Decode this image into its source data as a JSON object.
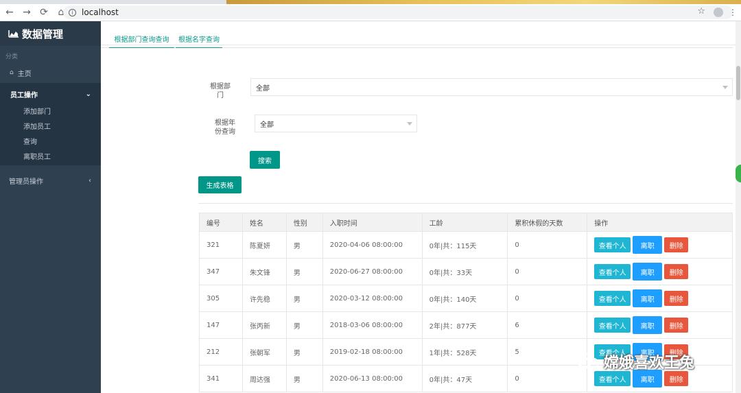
{
  "browser": {
    "url": "localhost",
    "nav_icons": [
      "back-icon",
      "forward-icon",
      "reload-icon",
      "home-icon"
    ],
    "back": "←",
    "forward": "→",
    "reload": "⟳",
    "home": "⌂",
    "info": "i",
    "star": "☆"
  },
  "sidebar": {
    "brand": "数据管理",
    "section_label": "分类",
    "home": "主页",
    "employee_group": {
      "label": "员工操作",
      "items": [
        "添加部门",
        "添加员工",
        "查询",
        "离职员工"
      ]
    },
    "admin_group": {
      "label": "管理员操作"
    }
  },
  "tabs": [
    "根据部门查询查询",
    "根据名字查询"
  ],
  "form": {
    "dept_label": "根据部\n门",
    "dept_value": "全部",
    "year_label": "根据年\n份查询",
    "year_value": "全部",
    "search_button": "搜索",
    "generate_button": "生成表格"
  },
  "table": {
    "headers": [
      "编号",
      "姓名",
      "性别",
      "入职时间",
      "工龄",
      "累积休假的天数",
      "操作"
    ],
    "rows": [
      [
        "321",
        "陈夏妍",
        "男",
        "2020-04-06 08:00:00",
        "0年|共：115天",
        "0"
      ],
      [
        "347",
        "朱文锋",
        "男",
        "2020-06-27 08:00:00",
        "0年|共：33天",
        "0"
      ],
      [
        "305",
        "许先稳",
        "男",
        "2020-03-12 08:00:00",
        "0年|共：140天",
        "0"
      ],
      [
        "147",
        "张丙新",
        "男",
        "2018-03-06 08:00:00",
        "2年|共：877天",
        "6"
      ],
      [
        "212",
        "张朝军",
        "男",
        "2019-02-18 08:00:00",
        "1年|共：528天",
        "5"
      ],
      [
        "341",
        "周达强",
        "男",
        "2020-06-13 08:00:00",
        "0年|共：47天",
        "0"
      ]
    ],
    "actions": {
      "view": "查看个人",
      "leave": "离职",
      "delete": "删除"
    }
  },
  "watermark": "嫦娥喜欢王兔",
  "colors": {
    "accent": "#009688",
    "sidebar": "#2f4050",
    "view": "#1eb6d3",
    "leave": "#1e9fff",
    "delete": "#e8573c"
  }
}
